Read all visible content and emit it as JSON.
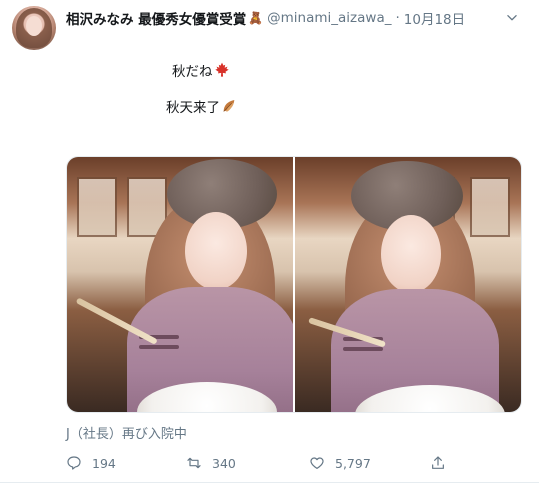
{
  "tweet": {
    "author": {
      "display_name": "相沢みなみ 最優秀女優賞受賞",
      "name_emoji": "🧸",
      "handle": "@minami_aizawa_",
      "separator": "·",
      "timestamp": "10月18日"
    },
    "text_lines": [
      {
        "text": "秋だね",
        "emoji": "maple-leaf"
      },
      {
        "text": "秋天来了",
        "emoji": "fallen-leaf"
      }
    ],
    "media": {
      "photos": [
        {
          "name": "photo-1"
        },
        {
          "name": "photo-2"
        }
      ]
    },
    "caption": "J（社長）再び入院中",
    "actions": {
      "reply_count": "194",
      "retweet_count": "340",
      "like_count": "5,797"
    }
  },
  "colors": {
    "text_primary": "#14171a",
    "text_secondary": "#657786",
    "border": "#e6ecf0",
    "maple_leaf": "#d8322a",
    "fallen_leaf": "#c47a3c"
  },
  "icons": [
    "avatar",
    "teddy-bear-emoji",
    "chevron-down-icon",
    "maple-leaf-emoji",
    "fallen-leaf-emoji",
    "reply-icon",
    "retweet-icon",
    "like-icon",
    "share-icon"
  ]
}
